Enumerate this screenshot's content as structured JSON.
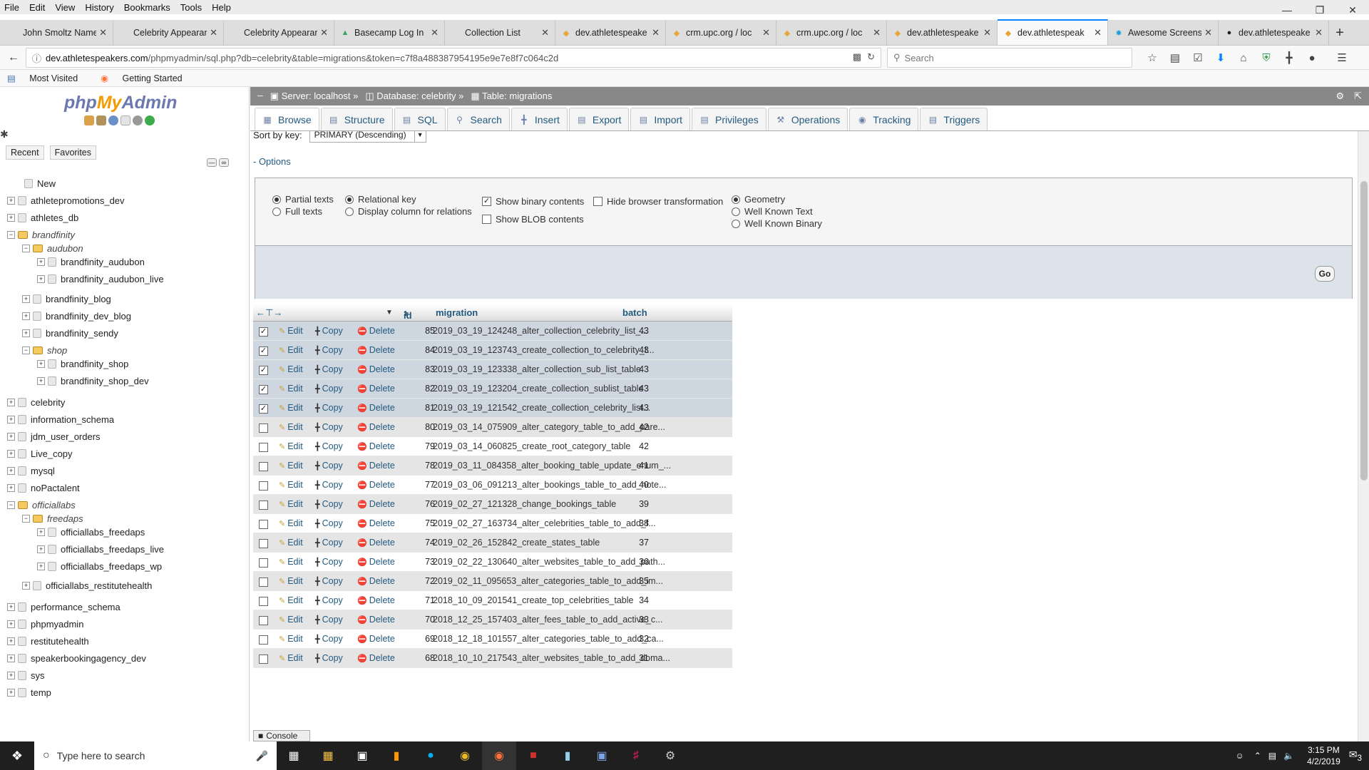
{
  "browser": {
    "menu": [
      "File",
      "Edit",
      "View",
      "History",
      "Bookmarks",
      "Tools",
      "Help"
    ],
    "tabs": [
      {
        "label": "John Smoltz Named C",
        "icon": "page-icon"
      },
      {
        "label": "Celebrity Appearance",
        "icon": "page-icon"
      },
      {
        "label": "Celebrity Appearance",
        "icon": "page-icon"
      },
      {
        "label": "Basecamp Log In",
        "icon": "basecamp-icon"
      },
      {
        "label": "Collection List",
        "icon": "page-icon"
      },
      {
        "label": "dev.athletespeake",
        "icon": "pma-icon"
      },
      {
        "label": "crm.upc.org / loc",
        "icon": "pma-icon"
      },
      {
        "label": "crm.upc.org / loc",
        "icon": "pma-icon"
      },
      {
        "label": "dev.athletespeake",
        "icon": "pma-icon"
      },
      {
        "label": "dev.athletespeak",
        "icon": "pma-icon",
        "active": true
      },
      {
        "label": "Awesome Screens",
        "icon": "awesome-icon"
      },
      {
        "label": "dev.athletespeake",
        "icon": "circle-icon"
      }
    ],
    "url_host": "dev.athletespeakers.com",
    "url_path": "/phpmyadmin/sql.php?db=celebrity&table=migrations&token=c7f8a488387954195e9e7e8f7c064c2d",
    "search_placeholder": "Search",
    "bookmarks": [
      "Most Visited",
      "Getting Started"
    ]
  },
  "pma": {
    "logo_php": "php",
    "logo_my": "My",
    "logo_admin": "Admin",
    "recent": "Recent",
    "favorites": "Favorites",
    "tree": [
      {
        "label": "New",
        "level": 0,
        "type": "new"
      },
      {
        "label": "athletepromotions_dev",
        "level": 0,
        "type": "db"
      },
      {
        "label": "athletes_db",
        "level": 0,
        "type": "db"
      },
      {
        "label": "brandfinity",
        "level": 0,
        "type": "group"
      },
      {
        "label": "audubon",
        "level": 1,
        "type": "group"
      },
      {
        "label": "brandfinity_audubon",
        "level": 2,
        "type": "db"
      },
      {
        "label": "brandfinity_audubon_live",
        "level": 2,
        "type": "db"
      },
      {
        "label": "brandfinity_blog",
        "level": 1,
        "type": "db"
      },
      {
        "label": "brandfinity_dev_blog",
        "level": 1,
        "type": "db"
      },
      {
        "label": "brandfinity_sendy",
        "level": 1,
        "type": "db"
      },
      {
        "label": "shop",
        "level": 1,
        "type": "group"
      },
      {
        "label": "brandfinity_shop",
        "level": 2,
        "type": "db"
      },
      {
        "label": "brandfinity_shop_dev",
        "level": 2,
        "type": "db"
      },
      {
        "label": "celebrity",
        "level": 0,
        "type": "db"
      },
      {
        "label": "information_schema",
        "level": 0,
        "type": "db"
      },
      {
        "label": "jdm_user_orders",
        "level": 0,
        "type": "db"
      },
      {
        "label": "Live_copy",
        "level": 0,
        "type": "db"
      },
      {
        "label": "mysql",
        "level": 0,
        "type": "db"
      },
      {
        "label": "noPactalent",
        "level": 0,
        "type": "db"
      },
      {
        "label": "officiallabs",
        "level": 0,
        "type": "group"
      },
      {
        "label": "freedaps",
        "level": 1,
        "type": "group"
      },
      {
        "label": "officiallabs_freedaps",
        "level": 2,
        "type": "db"
      },
      {
        "label": "officiallabs_freedaps_live",
        "level": 2,
        "type": "db"
      },
      {
        "label": "officiallabs_freedaps_wp",
        "level": 2,
        "type": "db"
      },
      {
        "label": "officiallabs_restitutehealth",
        "level": 1,
        "type": "db"
      },
      {
        "label": "performance_schema",
        "level": 0,
        "type": "db"
      },
      {
        "label": "phpmyadmin",
        "level": 0,
        "type": "db"
      },
      {
        "label": "restitutehealth",
        "level": 0,
        "type": "db"
      },
      {
        "label": "speakerbookingagency_dev",
        "level": 0,
        "type": "db"
      },
      {
        "label": "sys",
        "level": 0,
        "type": "db"
      },
      {
        "label": "temp",
        "level": 0,
        "type": "db"
      }
    ],
    "breadcrumb": {
      "server": "Server: localhost",
      "database": "Database: celebrity",
      "table": "Table: migrations"
    },
    "tabs": [
      "Browse",
      "Structure",
      "SQL",
      "Search",
      "Insert",
      "Export",
      "Import",
      "Privileges",
      "Operations",
      "Tracking",
      "Triggers"
    ],
    "sort_by_key_label": "Sort by key:",
    "sort_by_key_value": "PRIMARY (Descending)",
    "options_link": "- Options",
    "display_options": {
      "partial_texts": "Partial texts",
      "full_texts": "Full texts",
      "relational_key": "Relational key",
      "display_column": "Display column for relations",
      "show_binary": "Show binary contents",
      "show_blob": "Show BLOB contents",
      "hide_browser": "Hide browser transformation",
      "geometry": "Geometry",
      "well_known_text": "Well Known Text",
      "well_known_binary": "Well Known Binary"
    },
    "go": "Go",
    "columns": {
      "id": "id",
      "sort_num": "1",
      "migration": "migration",
      "batch": "batch"
    },
    "actions": {
      "edit": "Edit",
      "copy": "Copy",
      "delete": "Delete"
    },
    "rows": [
      {
        "id": "85",
        "migration": "2019_03_19_124248_alter_collection_celebrity_list_...",
        "batch": "43",
        "checked": true
      },
      {
        "id": "84",
        "migration": "2019_03_19_123743_create_collection_to_celebrity_t...",
        "batch": "43",
        "checked": true
      },
      {
        "id": "83",
        "migration": "2019_03_19_123338_alter_collection_sub_list_table",
        "batch": "43",
        "checked": true
      },
      {
        "id": "82",
        "migration": "2019_03_19_123204_create_collection_sublist_table",
        "batch": "43",
        "checked": true
      },
      {
        "id": "81",
        "migration": "2019_03_19_121542_create_collection_celebrity_list...",
        "batch": "43",
        "checked": true
      },
      {
        "id": "80",
        "migration": "2019_03_14_075909_alter_category_table_to_add_pare...",
        "batch": "42",
        "checked": false
      },
      {
        "id": "79",
        "migration": "2019_03_14_060825_create_root_category_table",
        "batch": "42",
        "checked": false
      },
      {
        "id": "78",
        "migration": "2019_03_11_084358_alter_booking_table_update_enum_...",
        "batch": "41",
        "checked": false
      },
      {
        "id": "77",
        "migration": "2019_03_06_091213_alter_bookings_table_to_add_note...",
        "batch": "40",
        "checked": false
      },
      {
        "id": "76",
        "migration": "2019_02_27_121328_change_bookings_table",
        "batch": "39",
        "checked": false
      },
      {
        "id": "75",
        "migration": "2019_02_27_163734_alter_celebrities_table_to_add_f...",
        "batch": "38",
        "checked": false
      },
      {
        "id": "74",
        "migration": "2019_02_26_152842_create_states_table",
        "batch": "37",
        "checked": false
      },
      {
        "id": "73",
        "migration": "2019_02_22_130640_alter_websites_table_to_add_path...",
        "batch": "36",
        "checked": false
      },
      {
        "id": "72",
        "migration": "2019_02_11_095653_alter_categories_table_to_add_im...",
        "batch": "35",
        "checked": false
      },
      {
        "id": "71",
        "migration": "2018_10_09_201541_create_top_celebrities_table",
        "batch": "34",
        "checked": false
      },
      {
        "id": "70",
        "migration": "2018_12_25_157403_alter_fees_table_to_add_active_c...",
        "batch": "33",
        "checked": false
      },
      {
        "id": "69",
        "migration": "2018_12_18_101557_alter_categories_table_to_add_ca...",
        "batch": "32",
        "checked": false
      },
      {
        "id": "68",
        "migration": "2018_10_10_217543_alter_websites_table_to_add_doma...",
        "batch": "31",
        "checked": false
      }
    ],
    "console": "Console"
  },
  "taskbar": {
    "search_placeholder": "Type here to search",
    "time": "3:15 PM",
    "date": "4/2/2019",
    "notification_count": "3"
  },
  "colors": {
    "link": "#235a81",
    "selected_row": "#ced6df",
    "topbar": "#888888"
  }
}
